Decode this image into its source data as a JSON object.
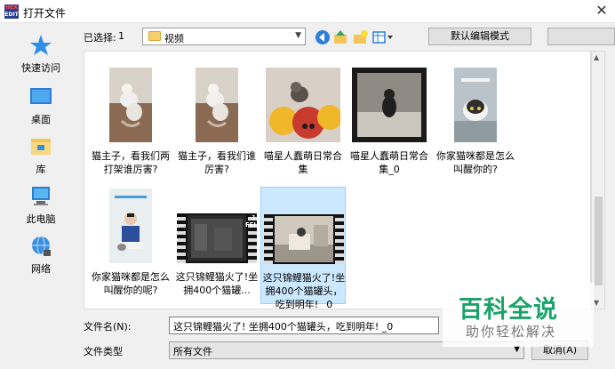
{
  "window": {
    "title": "打开文件",
    "app_icon_text": [
      "HEX",
      "EDIT"
    ],
    "close_glyph": "✕"
  },
  "sidebar": {
    "items": [
      {
        "label": "快速访问",
        "icon": "star-icon"
      },
      {
        "label": "桌面",
        "icon": "desktop-icon"
      },
      {
        "label": "库",
        "icon": "library-icon"
      },
      {
        "label": "此电脑",
        "icon": "computer-icon"
      },
      {
        "label": "网络",
        "icon": "network-icon"
      }
    ]
  },
  "toolbar": {
    "selected_label": "已选择:",
    "selected_count": "1",
    "folder_name": "视频",
    "default_edit_mode_label": "默认编辑模式"
  },
  "files": [
    {
      "label": "猫主子，看我们两打架谁厉害?",
      "thumb": "portrait-cat-fight"
    },
    {
      "label": "猫主子，看我们谁厉害?",
      "thumb": "portrait-cat-fight"
    },
    {
      "label": "喵星人蠢萌日常合集",
      "thumb": "wide-cat-pillows"
    },
    {
      "label": "喵星人蠢萌日常合集_0",
      "thumb": "wide-cat-dark"
    },
    {
      "label": "你家猫咪都是怎么叫醒你的?",
      "thumb": "portrait-cat-face"
    },
    {
      "label": "你家猫咪都是怎么叫醒你的呢?",
      "thumb": "portrait-person"
    },
    {
      "label": "这只锦鲤猫火了!坐拥400个猫罐...",
      "thumb": "film-dark",
      "badge": [
        "1",
        "FEI"
      ]
    },
    {
      "label": "这只锦鲤猫火了!坐拥400个猫罐头，吃到明年! _0",
      "thumb": "film-room",
      "selected": true
    }
  ],
  "form": {
    "filename_label": "文件名(N):",
    "filename_value": "这只锦鲤猫火了! 坐拥400个猫罐头，吃到明年! _0",
    "filetype_label": "文件类型",
    "filetype_value": "所有文件",
    "cancel_label": "取消(A)"
  },
  "watermark": {
    "brand": "百科全说",
    "sub": "助你轻松解决"
  },
  "colors": {
    "selection_bg": "#cce8ff",
    "selection_border": "#99d1ff",
    "watermark_green": "#1aa36b",
    "folder_yellow": "#f5cf6a"
  }
}
